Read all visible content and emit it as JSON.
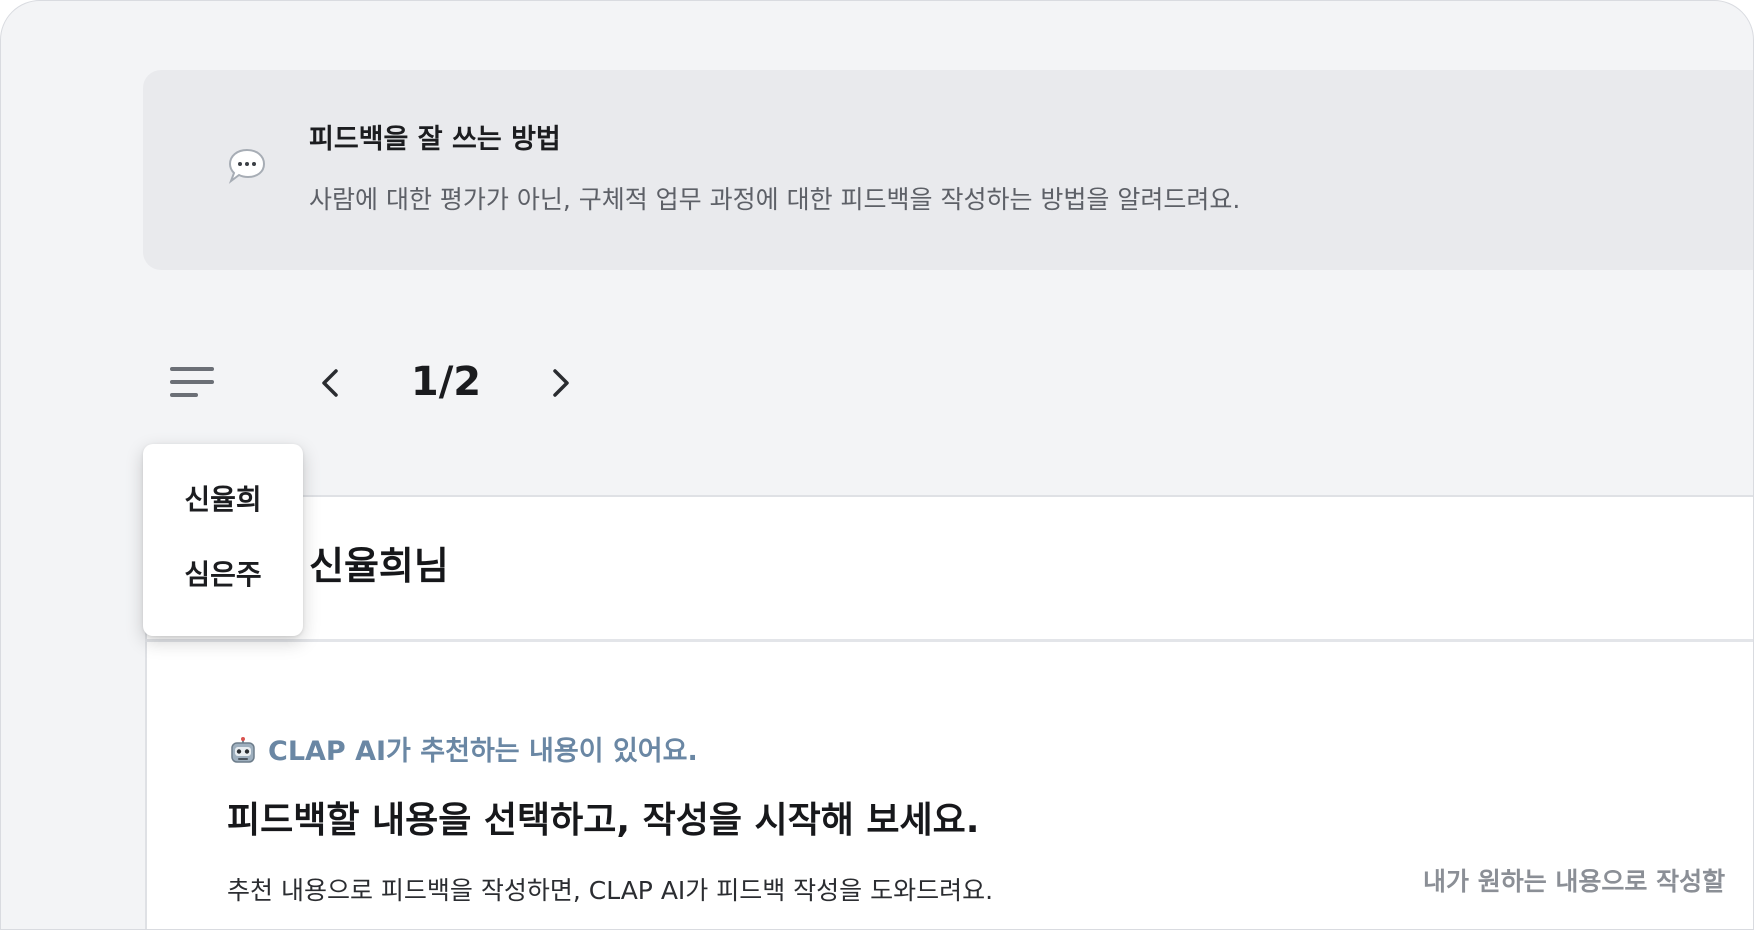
{
  "tip": {
    "title": "피드백을 잘 쓰는 방법",
    "description": "사람에 대한 평가가 아닌, 구체적 업무 과정에 대한 피드백을 작성하는 방법을 알려드려요."
  },
  "pager": {
    "text": "1/2"
  },
  "dropdown": {
    "items": [
      "신율희",
      "심은주"
    ]
  },
  "card": {
    "recipient": "신율희님",
    "ai_badge": "CLAP AI가 추천하는 내용이 있어요.",
    "title": "피드백할 내용을 선택하고, 작성을 시작해 보세요.",
    "description": "추천 내용으로 피드백을 작성하면, CLAP AI가 피드백 작성을 도와드려요.",
    "write_own": "내가 원하는 내용으로 작성할"
  },
  "icons": {
    "tip": "speech-bubble-icon",
    "menu": "menu-lines-icon",
    "prev": "chevron-left-icon",
    "next": "chevron-right-icon",
    "ai": "robot-icon"
  },
  "colors": {
    "background": "#f3f4f6",
    "tip_card": "#e9eaed",
    "ai_accent": "#6a87a4",
    "muted_text": "#8b8f96"
  }
}
